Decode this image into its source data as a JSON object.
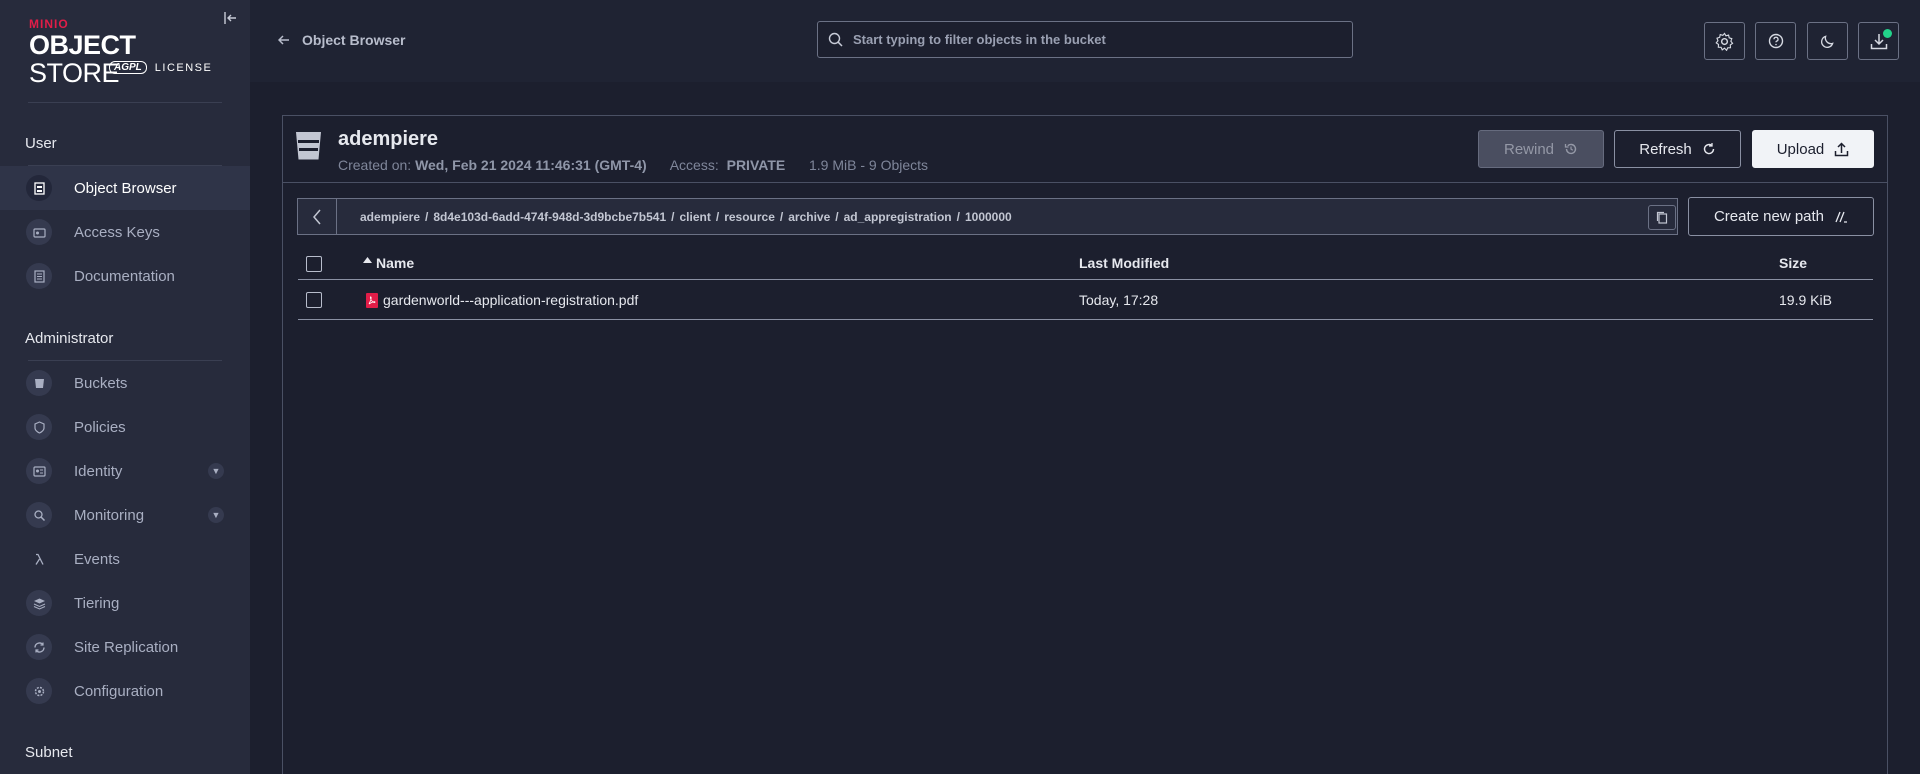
{
  "logo": {
    "minio": "MINIO",
    "object": "OBJECT",
    "store": " STORE",
    "agpl": "AGPL",
    "license": "LICENSE"
  },
  "sidebar": {
    "sections": [
      {
        "title": "User"
      },
      {
        "title": "Administrator"
      },
      {
        "title": "Subnet"
      }
    ],
    "user_items": [
      {
        "label": "Object Browser",
        "icon": "object-browser-icon"
      },
      {
        "label": "Access Keys",
        "icon": "access-keys-icon"
      },
      {
        "label": "Documentation",
        "icon": "documentation-icon"
      }
    ],
    "admin_items": [
      {
        "label": "Buckets",
        "icon": "bucket-icon"
      },
      {
        "label": "Policies",
        "icon": "policy-icon"
      },
      {
        "label": "Identity",
        "icon": "identity-icon"
      },
      {
        "label": "Monitoring",
        "icon": "monitoring-icon"
      },
      {
        "label": "Events",
        "icon": "lambda-icon"
      },
      {
        "label": "Tiering",
        "icon": "tiering-icon"
      },
      {
        "label": "Site Replication",
        "icon": "replication-icon"
      },
      {
        "label": "Configuration",
        "icon": "gear-icon"
      }
    ]
  },
  "topbar": {
    "back_label": "Object Browser",
    "search_placeholder": "Start typing to filter objects in the bucket"
  },
  "bucket": {
    "name": "adempiere",
    "created_label": "Created on:",
    "created_value": "Wed, Feb 21 2024 11:46:31 (GMT-4)",
    "access_label": "Access:",
    "access_value": "PRIVATE",
    "summary": "1.9 MiB - 9 Objects",
    "rewind_label": "Rewind",
    "refresh_label": "Refresh",
    "upload_label": "Upload"
  },
  "breadcrumb": {
    "parts": [
      "adempiere",
      "8d4e103d-6add-474f-948d-3d9bcbe7b541",
      "client",
      "resource",
      "archive",
      "ad_appregistration",
      "1000000"
    ],
    "separator": "/",
    "new_path_label": "Create new path"
  },
  "table": {
    "columns": {
      "name": "Name",
      "modified": "Last Modified",
      "size": "Size"
    },
    "rows": [
      {
        "name": "gardenworld---application-registration.pdf",
        "modified": "Today, 17:28",
        "size": "19.9 KiB"
      }
    ]
  },
  "colors": {
    "accent": "#e11d48",
    "sidebar_bg": "#272b3c",
    "main_bg": "#1c1f2e",
    "status_dot": "#22d28a"
  }
}
